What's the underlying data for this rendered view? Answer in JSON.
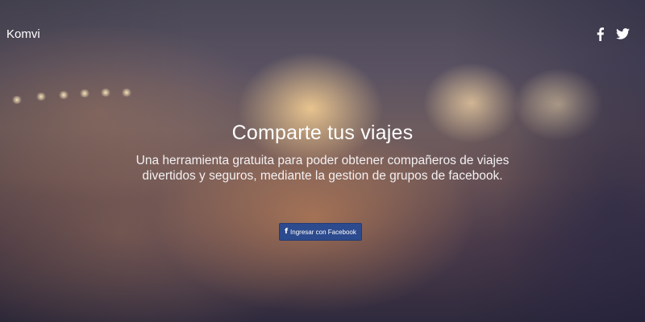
{
  "navbar": {
    "brand": "Komvi",
    "social": [
      {
        "icon": "facebook-icon",
        "glyph": "f"
      },
      {
        "icon": "twitter-icon"
      }
    ]
  },
  "hero": {
    "title": "Comparte tus viajes",
    "subtitle": "Una herramienta gratuita para poder obtener compañeros de viajes divertidos y seguros, mediante la gestion de grupos de facebook.",
    "login_button": {
      "icon": "facebook-icon",
      "glyph": "f",
      "label": "Ingresar con Facebook",
      "color": "#2c4a8e"
    }
  }
}
